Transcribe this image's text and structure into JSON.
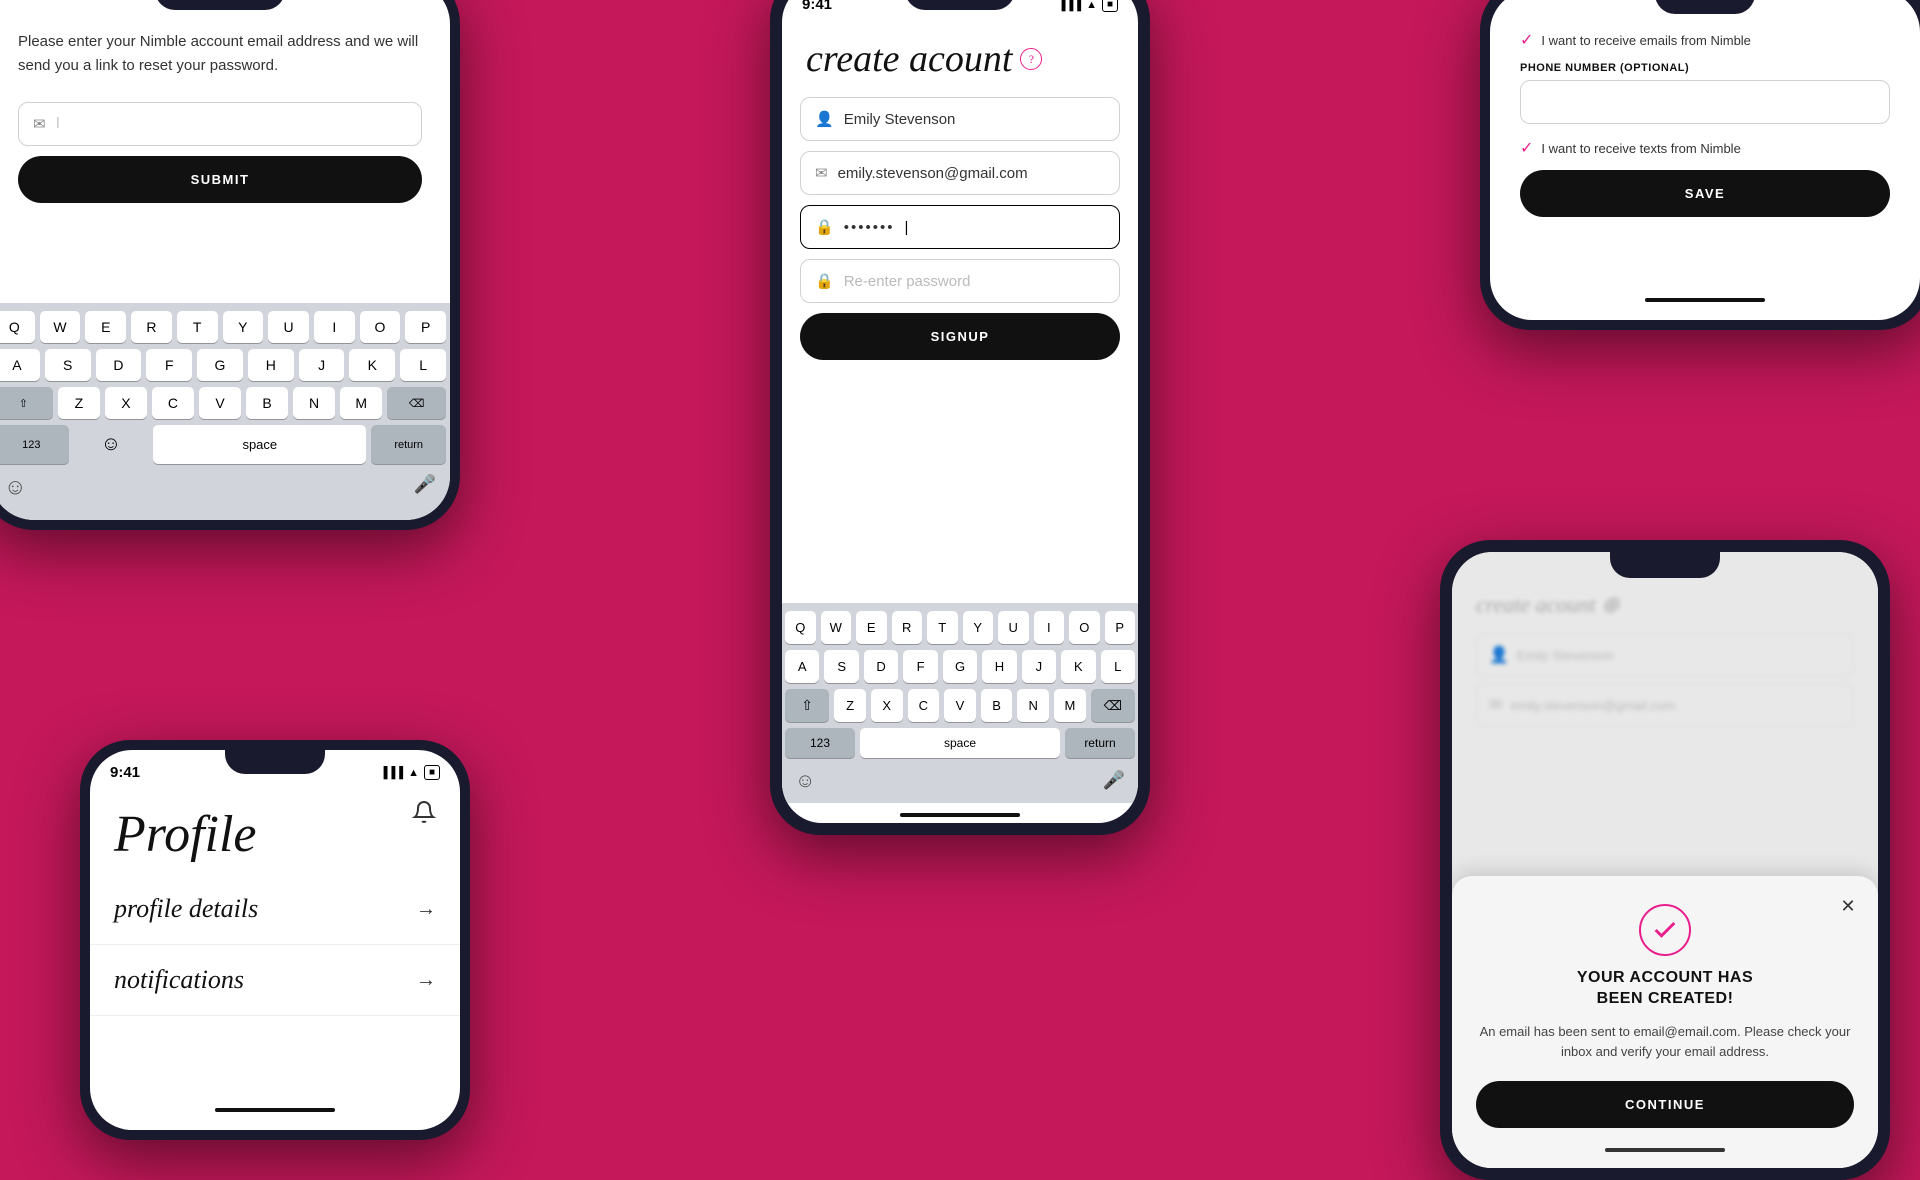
{
  "background_color": "#C4185A",
  "phones": {
    "phone1": {
      "label": "password-reset-phone",
      "description_text": "Please enter your Nimble account email address and we will send you a link to reset your password.",
      "email_placeholder": "I",
      "submit_button": "SUBMIT",
      "keyboard_rows": [
        [
          "Q",
          "W",
          "E",
          "R",
          "T",
          "Y",
          "U",
          "I",
          "O",
          "P"
        ],
        [
          "A",
          "S",
          "D",
          "F",
          "G",
          "H",
          "J",
          "K",
          "L"
        ],
        [
          "Z",
          "X",
          "C",
          "V",
          "B",
          "N",
          "M"
        ]
      ],
      "special_keys": [
        "123",
        "space",
        "return"
      ],
      "shift_symbol": "⇧",
      "delete_symbol": "⌫"
    },
    "phone2": {
      "label": "create-account-phone",
      "status_time": "9:41",
      "title": "create acount",
      "title_has_help": true,
      "name_value": "Emily Stevenson",
      "email_value": "emily.stevenson@gmail.com",
      "password_value": "•••••••",
      "password_placeholder": "Re-enter password",
      "signup_button": "SIGNUP",
      "keyboard_rows": [
        [
          "Q",
          "W",
          "E",
          "R",
          "T",
          "Y",
          "U",
          "I",
          "O",
          "P"
        ],
        [
          "A",
          "S",
          "D",
          "F",
          "G",
          "H",
          "J",
          "K",
          "L"
        ],
        [
          "Z",
          "X",
          "C",
          "V",
          "B",
          "N",
          "M"
        ]
      ],
      "special_keys": [
        "123",
        "space",
        "return"
      ]
    },
    "phone3": {
      "label": "profile-settings-phone",
      "checkbox1_text": "I want to receive emails from Nimble",
      "phone_label": "PHONE NUMBER (OPTIONAL)",
      "phone_placeholder": "",
      "checkbox2_text": "I want to receive texts from Nimble",
      "save_button": "SAVE"
    },
    "phone4": {
      "label": "profile-phone",
      "status_time": "9:41",
      "title": "Profile",
      "item1_label": "profile details",
      "item2_label": "notifications",
      "arrow": "→"
    },
    "phone5": {
      "label": "account-created-phone",
      "modal": {
        "title": "YOUR ACCOUNT HAS\nBEEN CREATED!",
        "body": "An email has been sent to email@email.com. Please check your inbox and verify your email address.",
        "button": "CONTINUE",
        "close_icon": "✕"
      }
    }
  }
}
